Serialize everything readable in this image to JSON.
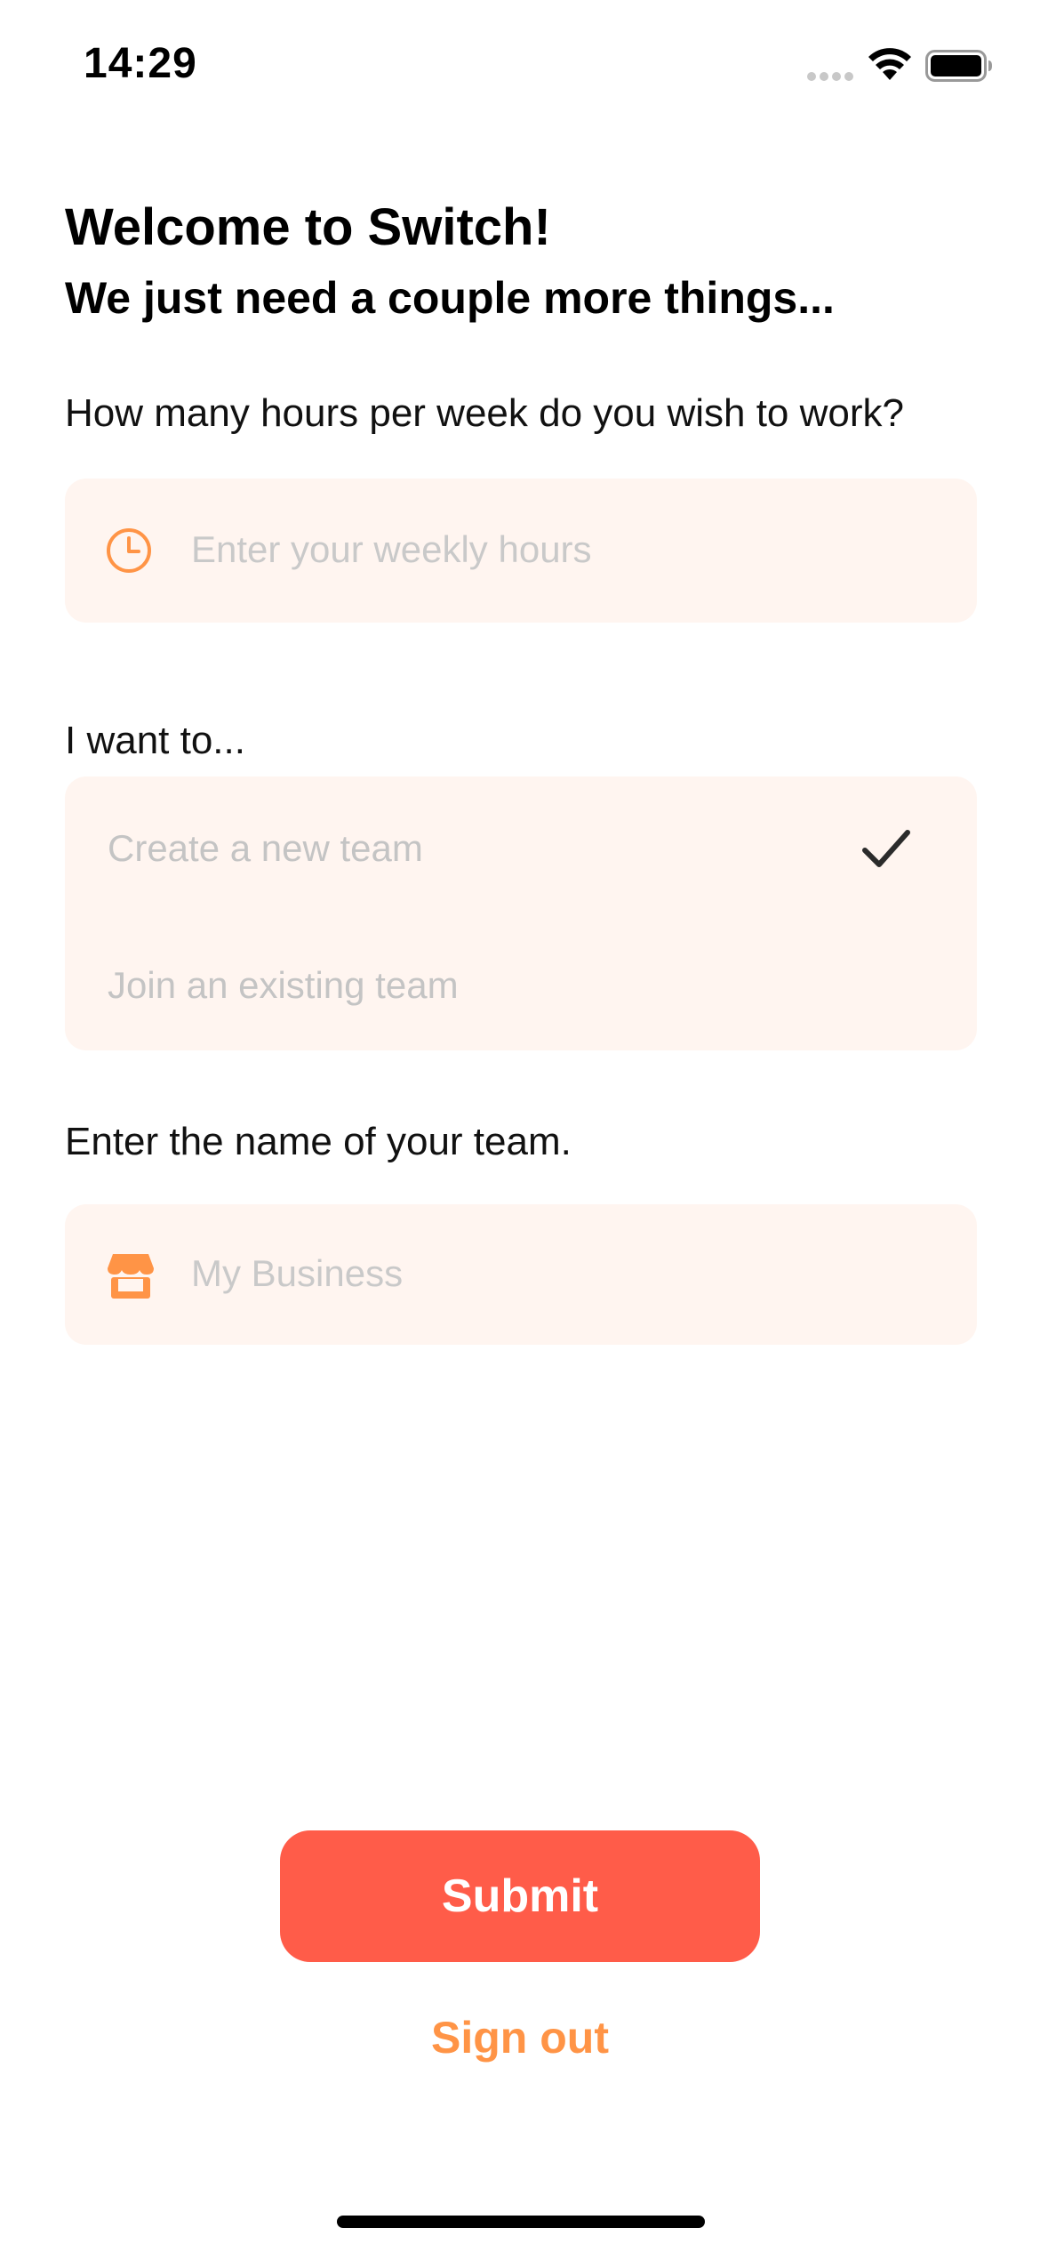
{
  "status_bar": {
    "time": "14:29",
    "icons": [
      "cellular-signal-icon",
      "wifi-icon",
      "battery-icon"
    ]
  },
  "header": {
    "title": "Welcome to Switch!",
    "subtitle": "We just need a couple more things..."
  },
  "hours": {
    "label": "How many hours per week do you wish to work?",
    "placeholder": "Enter your weekly hours",
    "icon": "clock-icon"
  },
  "intent": {
    "label": "I want to...",
    "options": [
      {
        "label": "Create a new team",
        "selected": true
      },
      {
        "label": "Join an existing team",
        "selected": false
      }
    ]
  },
  "team_name": {
    "label": "Enter the name of your team.",
    "placeholder": "My Business",
    "icon": "storefront-icon"
  },
  "actions": {
    "submit_label": "Submit",
    "signout_label": "Sign out"
  },
  "colors": {
    "accent_orange": "#ff9446",
    "submit_red": "#ff5c49",
    "field_background": "#fff5f0"
  }
}
